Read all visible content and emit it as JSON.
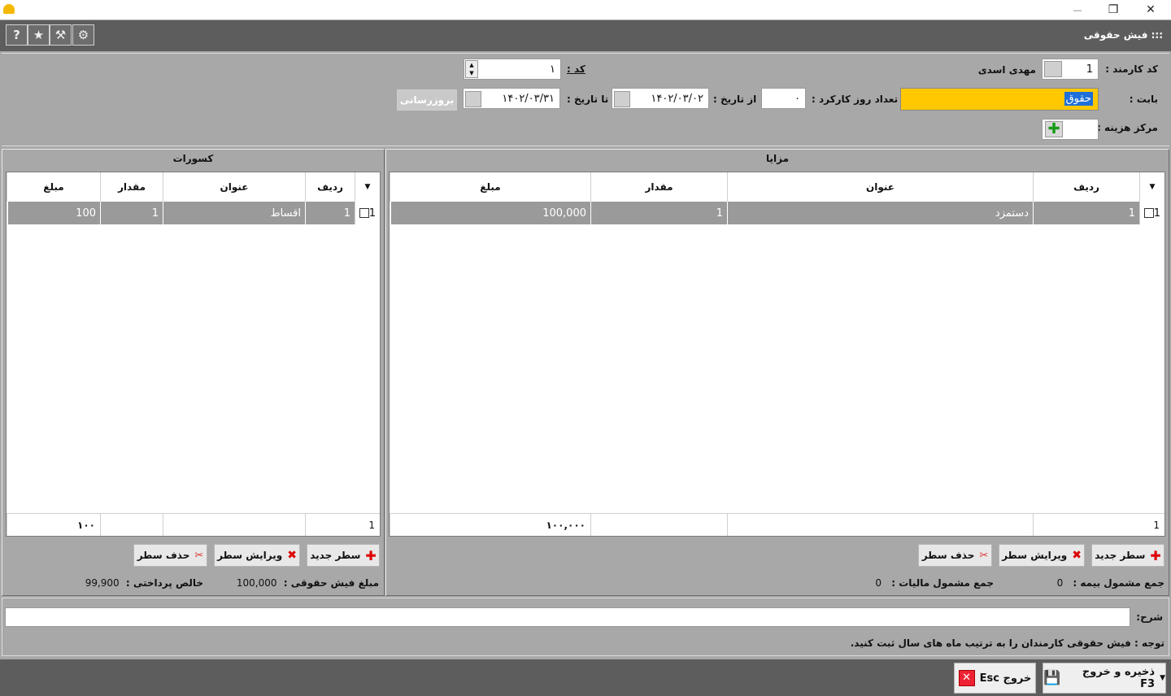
{
  "window": {
    "title": "",
    "minimize": "—",
    "maximize": "❐",
    "close": "✕"
  },
  "toolbar": {
    "title": ":::  فیش حقوقی",
    "buttons": [
      {
        "icon": "gear-icon",
        "glyph": "⚙"
      },
      {
        "icon": "tools-icon",
        "glyph": "⚒"
      },
      {
        "icon": "star-icon",
        "glyph": "★"
      },
      {
        "icon": "help-icon",
        "glyph": "?"
      }
    ]
  },
  "form": {
    "employee_code_label": "کد کارمند :",
    "employee_code": "1",
    "employee_name": "مهدی اسدی",
    "code_label": "کد :",
    "code": "۱",
    "babat_label": "بابت :",
    "babat": "حقوق",
    "work_days_label": "تعداد روز کارکرد :",
    "work_days": "۰",
    "from_date_label": "از تاریخ :",
    "from_date": "۱۴۰۲/۰۳/۰۲",
    "to_date_label": "تا تاریخ :",
    "to_date": "۱۴۰۲/۰۳/۳۱",
    "update_button": "بروزرسانی",
    "cost_center_label": "مرکز هزینه :"
  },
  "benefits": {
    "title": "مزایا",
    "headers": {
      "row": "ردیف",
      "title": "عنوان",
      "qty": "مقدار",
      "amount": "مبلغ"
    },
    "rows": [
      {
        "idx": "1",
        "row": "1",
        "title": "دستمزد",
        "qty": "1",
        "amount": "100,000"
      }
    ],
    "footer": {
      "count": "1",
      "amount": "۱۰۰,۰۰۰"
    },
    "buttons": {
      "new": "سطر جدید",
      "edit": "ویرایش سطر",
      "delete": "حذف سطر"
    },
    "insurance_label": "جمع مشمول بیمه :",
    "insurance_value": "0",
    "tax_label": "جمع مشمول مالیات :",
    "tax_value": "0"
  },
  "deductions": {
    "title": "کسورات",
    "headers": {
      "row": "ردیف",
      "title": "عنوان",
      "qty": "مقدار",
      "amount": "مبلغ"
    },
    "rows": [
      {
        "idx": "1",
        "row": "1",
        "title": "اقساط",
        "qty": "1",
        "amount": "100"
      }
    ],
    "footer": {
      "count": "1",
      "amount": "۱۰۰"
    },
    "buttons": {
      "new": "سطر جدید",
      "edit": "ویرایش سطر",
      "delete": "حذف سطر"
    },
    "slip_amount_label": "مبلغ فیش حقوقی :",
    "slip_amount": "100,000",
    "net_label": "خالص پرداختی :",
    "net_value": "99,900"
  },
  "description": {
    "label": "شرح:",
    "value": "",
    "note": "توجه :  فیش حقوقی کارمندان را به ترتیب ماه های سال ثبت کنید."
  },
  "footer": {
    "save_label": "ذخیره و خروج F3",
    "exit_label": "خروج Esc"
  },
  "colors": {
    "highlight": "#ffc800",
    "selection": "#1e6fd9",
    "row_selected": "#9a9a9a"
  }
}
